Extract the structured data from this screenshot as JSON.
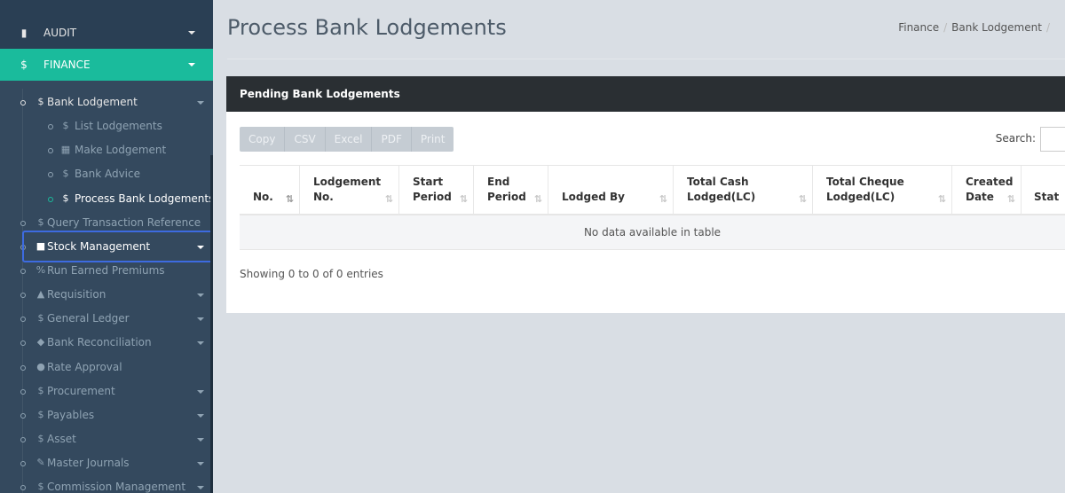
{
  "sidebar": {
    "top_items": [
      {
        "label": "AUDIT",
        "icon": "book-icon"
      },
      {
        "label": "FINANCE",
        "icon": "money-icon"
      }
    ],
    "items": [
      {
        "label": "Bank Lodgement",
        "icon": "money-icon"
      },
      {
        "label": "List Lodgements",
        "icon": "money-icon"
      },
      {
        "label": "Make Lodgement",
        "icon": "table-icon"
      },
      {
        "label": "Bank Advice",
        "icon": "money-icon"
      },
      {
        "label": "Process Bank Lodgements",
        "icon": "money-icon"
      },
      {
        "label": "Query Transaction Reference",
        "icon": "money-icon"
      },
      {
        "label": "Stock Management",
        "icon": "shopping-bag-icon"
      },
      {
        "label": "Run Earned Premiums",
        "icon": "percent-icon"
      },
      {
        "label": "Requisition",
        "icon": "bell-icon"
      },
      {
        "label": "General Ledger",
        "icon": "money-icon"
      },
      {
        "label": "Bank Reconciliation",
        "icon": "diamond-icon"
      },
      {
        "label": "Rate Approval",
        "icon": "gear-icon"
      },
      {
        "label": "Procurement",
        "icon": "money-icon"
      },
      {
        "label": "Payables",
        "icon": "money-icon"
      },
      {
        "label": "Asset",
        "icon": "money-icon"
      },
      {
        "label": "Master Journals",
        "icon": "journal-icon"
      },
      {
        "label": "Commission Management",
        "icon": "money-icon"
      }
    ]
  },
  "header": {
    "title": "Process Bank Lodgements",
    "breadcrumb": [
      "Finance",
      "Bank Lodgement"
    ]
  },
  "panel": {
    "title": "Pending Bank Lodgements",
    "buttons": [
      "Copy",
      "CSV",
      "Excel",
      "PDF",
      "Print"
    ],
    "search_label": "Search:",
    "search_value": "",
    "columns": [
      "No.",
      "Lodgement No.",
      "Start Period",
      "End Period",
      "Lodged By",
      "Total Cash Lodged(LC)",
      "Total Cheque Lodged(LC)",
      "Created Date",
      "Stat"
    ],
    "empty_message": "No data available in table",
    "info": "Showing 0 to 0 of 0 entries"
  },
  "colors": {
    "sidebar_bg": "#2a3f54",
    "accent": "#1abb9c",
    "panel_header": "#2a2f33",
    "highlight": "#3d6be0"
  }
}
